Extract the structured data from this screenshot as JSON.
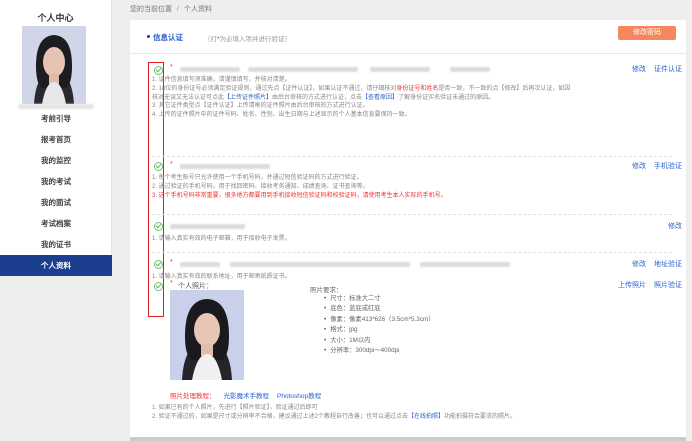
{
  "sidebar": {
    "title": "个人中心",
    "items": [
      {
        "label": "考前引导",
        "active": false
      },
      {
        "label": "报考首页",
        "active": false
      },
      {
        "label": "我的监控",
        "active": false
      },
      {
        "label": "我的考试",
        "active": false
      },
      {
        "label": "我的面试",
        "active": false
      },
      {
        "label": "考试档案",
        "active": false
      },
      {
        "label": "我的证书",
        "active": false
      },
      {
        "label": "个人资料",
        "active": true
      }
    ]
  },
  "breadcrumb": {
    "location": "您的当前位置",
    "current": "个人资料"
  },
  "tab": {
    "label": "信息认证",
    "hint_prefix": "（打",
    "hint_star": "*",
    "hint_suffix": "为必填入项并进行验证）"
  },
  "buttons": {
    "change_password": "修改密码"
  },
  "section1": {
    "links": [
      "修改",
      "证件认证"
    ],
    "notes": [
      "1. 证件信息填写须准确，请谨慎填写，并核对清楚。",
      "2. 18位的身份证号必须满足验证规则，通过先点【证件认证】，如果认证不通过，请仔细核对身份证号和姓名是否一致，不一致的点【修改】后再次认证，如因",
      "核对无误又无法认证可点此【上传证件照片】由后台审核的方式进行认证，点击【查看原因】了解身份证实名验证未通过的原因。",
      "3. 其它证件类型点【证件认证】上传清晰的证件照片由后台审核的方式进行认证。",
      "4. 上传的证件照片中的证件号码、姓名、性别、出生日期与上述显示的个人基本信息要保持一致。"
    ]
  },
  "section2": {
    "links": [
      "修改",
      "手机验证"
    ],
    "notes": [
      "1. 每个考生账号只允许使用一个手机号码，并通过短信验证码的方式进行验证。",
      "2. 通过验证的手机号码，用于找回密码、接收考务通知、成绩查询、证书查询等。",
      "3. 这个手机号码非常重要，很多地方都要用到手机接收短信验证码和校验证码，请使用考生本人实际的手机号。"
    ]
  },
  "section3": {
    "links": [
      "修改"
    ],
    "notes": [
      "1. 请输入真实有效的电子邮箱，用于接收电子发票。"
    ]
  },
  "section4": {
    "links": [
      "修改",
      "地址验证"
    ],
    "notes": [
      "1. 请输入真实有效的联系地址，用于邮寄纸质证书。"
    ]
  },
  "section5": {
    "field_label": "个人照片：",
    "links": [
      "上传照片",
      "照片验证"
    ],
    "req_title": "照片要求：",
    "requirements": [
      "尺寸：标准大二寸",
      "底色：蓝底或红底",
      "像素：像素413*626（3.5cm*5.3cm）",
      "格式：jpg",
      "大小：1M以内",
      "分辨率：300dpi～400dpi"
    ],
    "tutorial_label": "照片处理教程：",
    "tutorials": [
      "光影魔术手教程",
      "Photoshop教程"
    ],
    "notes": [
      "1. 如果已有的个人照片，先进行【照片验证】，验证通过后即可",
      "2. 验证不通过的，如果是尺寸或分辨率不合格，建议通过上述2个教程自行改善；也可以通过点击【在线拍照】功能拍摄符合要求的照片。"
    ]
  },
  "colors": {
    "nav_active": "#1b3e8e",
    "link": "#2a62c9",
    "button": "#f5865d",
    "alert": "#e33333",
    "check": "#5bb35b",
    "highlight_box": "#e02020"
  }
}
